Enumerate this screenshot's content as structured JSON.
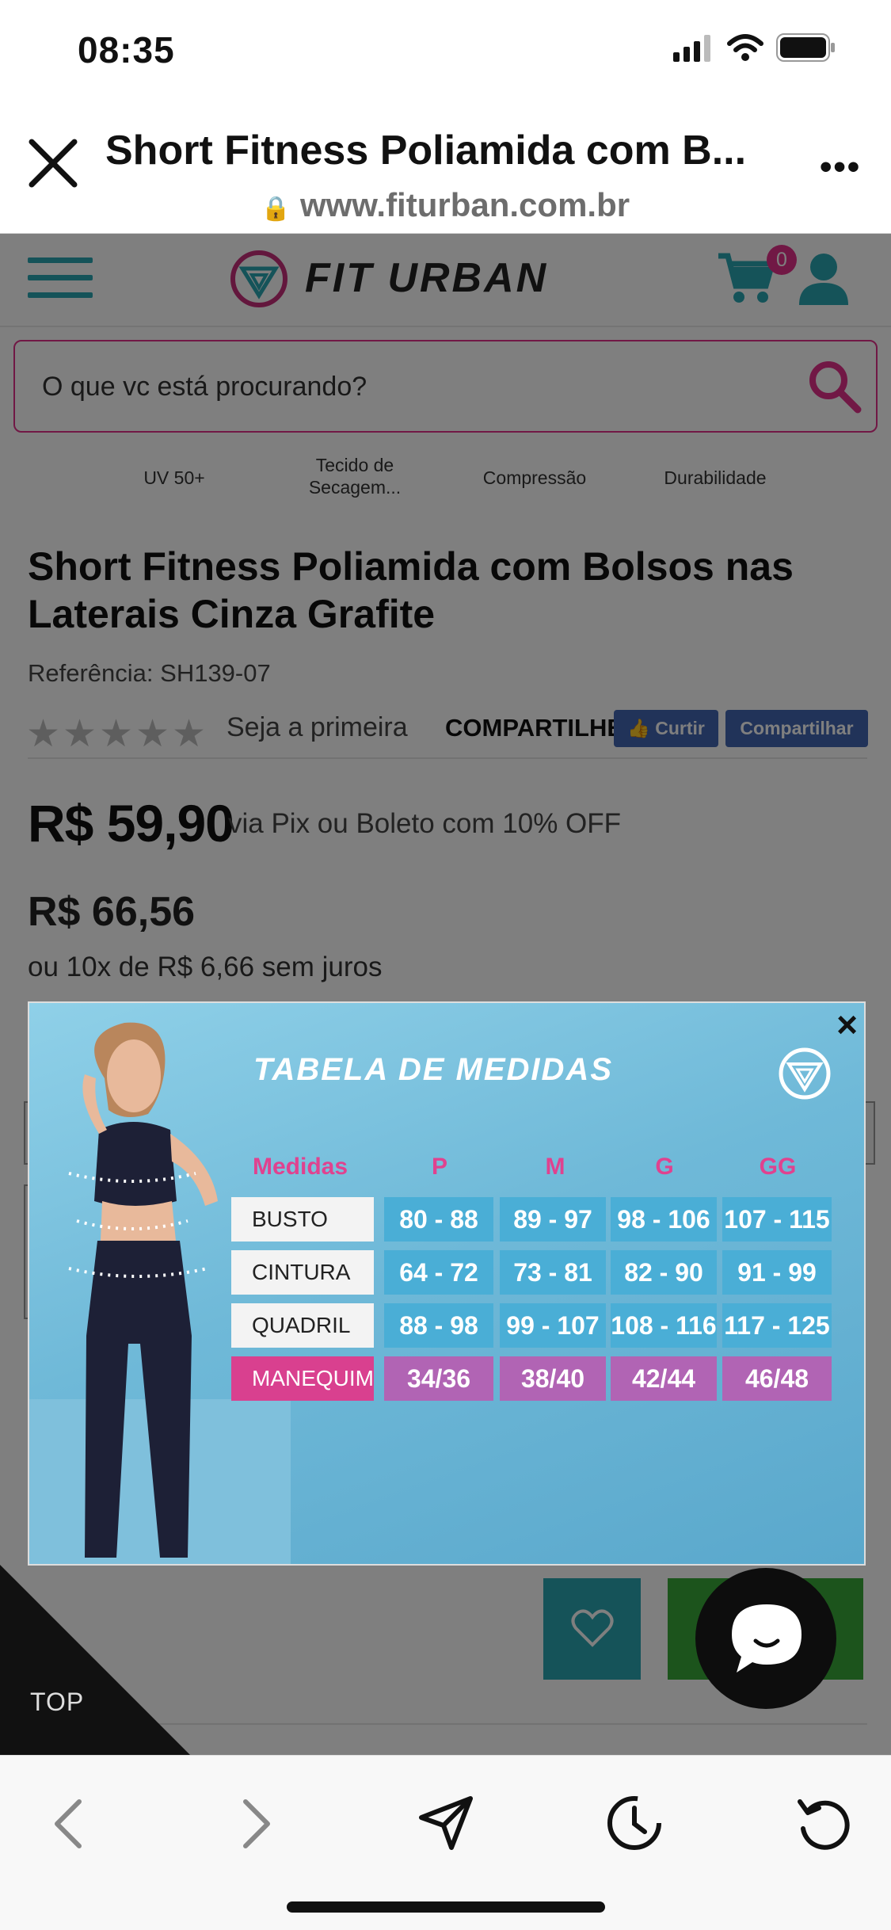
{
  "status_bar": {
    "time": "08:35"
  },
  "browser": {
    "title": "Short Fitness Poliamida com B...",
    "url": "www.fiturban.com.br"
  },
  "site": {
    "logo": "FIT URBAN",
    "cart_count": "0",
    "search_placeholder": "O que vc está procurando?",
    "features": [
      "UV 50+",
      "Tecido de Secagem...",
      "Compressão",
      "Durabilidade"
    ]
  },
  "product": {
    "title": "Short Fitness Poliamida com Bolsos nas Laterais Cinza Grafite",
    "reference": "Referência: SH139-07",
    "rating_text": "Seja a primeira",
    "share_label": "COMPARTILHE:",
    "like_button": "Curtir",
    "share_button": "Compartilhar",
    "price": "R$ 59,90",
    "price_note": "via Pix ou Boleto com 10% OFF",
    "old_price": "R$ 66,56",
    "installments": "ou 10x de R$ 6,66 sem juros"
  },
  "size_chart": {
    "title": "TABELA DE MEDIDAS",
    "header_label": "Medidas",
    "sizes": [
      "P",
      "M",
      "G",
      "GG"
    ],
    "rows": [
      {
        "label": "BUSTO",
        "values": [
          "80 - 88",
          "89 - 97",
          "98 - 106",
          "107 - 115"
        ]
      },
      {
        "label": "CINTURA",
        "values": [
          "64 - 72",
          "73 - 81",
          "82 - 90",
          "91 - 99"
        ]
      },
      {
        "label": "QUADRIL",
        "values": [
          "88 - 98",
          "99 - 107",
          "108 - 116",
          "117 - 125"
        ]
      },
      {
        "label": "MANEQUIM",
        "values": [
          "34/36",
          "38/40",
          "42/44",
          "46/48"
        ]
      }
    ],
    "close": "×"
  },
  "page_controls": {
    "top_label": "TOP"
  },
  "colors": {
    "accent_teal": "#2aa6b2",
    "accent_pink": "#e2318a",
    "buy_green": "#38a838"
  }
}
